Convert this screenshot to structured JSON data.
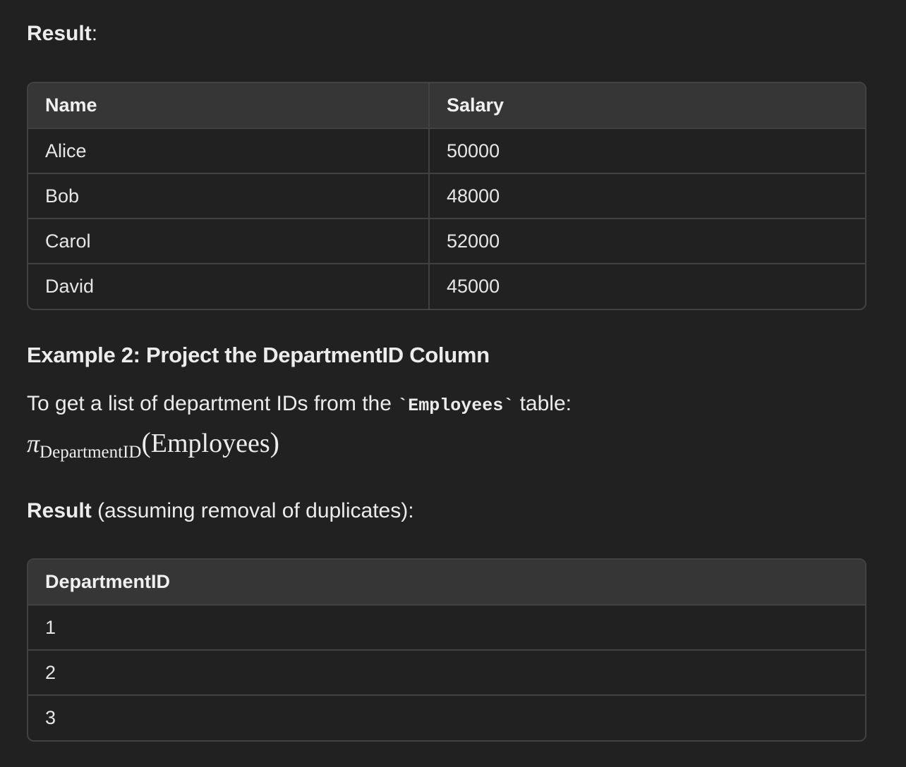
{
  "result1": {
    "bold": "Result",
    "suffix": ":"
  },
  "table1": {
    "headers": [
      "Name",
      "Salary"
    ],
    "rows": [
      [
        "Alice",
        "50000"
      ],
      [
        "Bob",
        "48000"
      ],
      [
        "Carol",
        "52000"
      ],
      [
        "David",
        "45000"
      ]
    ]
  },
  "example2": {
    "heading": "Example 2: Project the DepartmentID Column",
    "intro_before": "To get a list of department IDs from the ",
    "intro_code": "`Employees`",
    "intro_after": " table:",
    "math": {
      "operator": "π",
      "subscript": "DepartmentID",
      "open": "(",
      "argument": "Employees",
      "close": ")"
    }
  },
  "result2": {
    "bold": "Result",
    "rest": " (assuming removal of duplicates):"
  },
  "table2": {
    "headers": [
      "DepartmentID"
    ],
    "rows": [
      [
        "1"
      ],
      [
        "2"
      ],
      [
        "3"
      ]
    ]
  }
}
